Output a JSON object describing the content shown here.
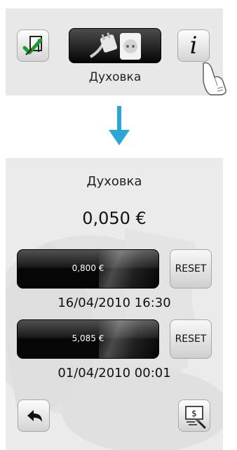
{
  "instruction": {
    "device_label": "Духовка",
    "info_symbol": "i",
    "icons": {
      "confirm": "check-document-icon",
      "device": "plug-socket-icon",
      "info": "info-icon",
      "pointer": "hand-pointer-icon"
    }
  },
  "arrow": {
    "icon": "down-arrow-icon",
    "color": "#2aa7d6"
  },
  "screen": {
    "title": "Духовка",
    "total_cost": "0,050 €",
    "counters": [
      {
        "value": "0,800 €",
        "reset_label": "RESET",
        "date": "16/04/2010 16:30"
      },
      {
        "value": "5,085 €",
        "reset_label": "RESET",
        "date": "01/04/2010 00:01"
      }
    ],
    "icons": {
      "back": "back-arrow-icon",
      "cost_settings": "money-settings-icon"
    }
  }
}
